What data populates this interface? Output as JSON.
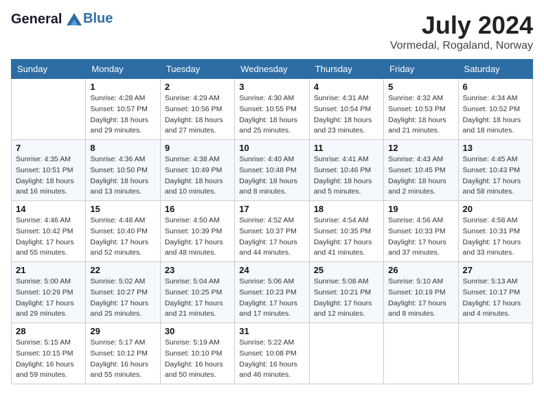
{
  "header": {
    "logo_line1": "General",
    "logo_line2": "Blue",
    "month": "July 2024",
    "location": "Vormedal, Rogaland, Norway"
  },
  "weekdays": [
    "Sunday",
    "Monday",
    "Tuesday",
    "Wednesday",
    "Thursday",
    "Friday",
    "Saturday"
  ],
  "weeks": [
    [
      {
        "day": "",
        "sunrise": "",
        "sunset": "",
        "daylight": ""
      },
      {
        "day": "1",
        "sunrise": "Sunrise: 4:28 AM",
        "sunset": "Sunset: 10:57 PM",
        "daylight": "Daylight: 18 hours and 29 minutes."
      },
      {
        "day": "2",
        "sunrise": "Sunrise: 4:29 AM",
        "sunset": "Sunset: 10:56 PM",
        "daylight": "Daylight: 18 hours and 27 minutes."
      },
      {
        "day": "3",
        "sunrise": "Sunrise: 4:30 AM",
        "sunset": "Sunset: 10:55 PM",
        "daylight": "Daylight: 18 hours and 25 minutes."
      },
      {
        "day": "4",
        "sunrise": "Sunrise: 4:31 AM",
        "sunset": "Sunset: 10:54 PM",
        "daylight": "Daylight: 18 hours and 23 minutes."
      },
      {
        "day": "5",
        "sunrise": "Sunrise: 4:32 AM",
        "sunset": "Sunset: 10:53 PM",
        "daylight": "Daylight: 18 hours and 21 minutes."
      },
      {
        "day": "6",
        "sunrise": "Sunrise: 4:34 AM",
        "sunset": "Sunset: 10:52 PM",
        "daylight": "Daylight: 18 hours and 18 minutes."
      }
    ],
    [
      {
        "day": "7",
        "sunrise": "Sunrise: 4:35 AM",
        "sunset": "Sunset: 10:51 PM",
        "daylight": "Daylight: 18 hours and 16 minutes."
      },
      {
        "day": "8",
        "sunrise": "Sunrise: 4:36 AM",
        "sunset": "Sunset: 10:50 PM",
        "daylight": "Daylight: 18 hours and 13 minutes."
      },
      {
        "day": "9",
        "sunrise": "Sunrise: 4:38 AM",
        "sunset": "Sunset: 10:49 PM",
        "daylight": "Daylight: 18 hours and 10 minutes."
      },
      {
        "day": "10",
        "sunrise": "Sunrise: 4:40 AM",
        "sunset": "Sunset: 10:48 PM",
        "daylight": "Daylight: 18 hours and 8 minutes."
      },
      {
        "day": "11",
        "sunrise": "Sunrise: 4:41 AM",
        "sunset": "Sunset: 10:46 PM",
        "daylight": "Daylight: 18 hours and 5 minutes."
      },
      {
        "day": "12",
        "sunrise": "Sunrise: 4:43 AM",
        "sunset": "Sunset: 10:45 PM",
        "daylight": "Daylight: 18 hours and 2 minutes."
      },
      {
        "day": "13",
        "sunrise": "Sunrise: 4:45 AM",
        "sunset": "Sunset: 10:43 PM",
        "daylight": "Daylight: 17 hours and 58 minutes."
      }
    ],
    [
      {
        "day": "14",
        "sunrise": "Sunrise: 4:46 AM",
        "sunset": "Sunset: 10:42 PM",
        "daylight": "Daylight: 17 hours and 55 minutes."
      },
      {
        "day": "15",
        "sunrise": "Sunrise: 4:48 AM",
        "sunset": "Sunset: 10:40 PM",
        "daylight": "Daylight: 17 hours and 52 minutes."
      },
      {
        "day": "16",
        "sunrise": "Sunrise: 4:50 AM",
        "sunset": "Sunset: 10:39 PM",
        "daylight": "Daylight: 17 hours and 48 minutes."
      },
      {
        "day": "17",
        "sunrise": "Sunrise: 4:52 AM",
        "sunset": "Sunset: 10:37 PM",
        "daylight": "Daylight: 17 hours and 44 minutes."
      },
      {
        "day": "18",
        "sunrise": "Sunrise: 4:54 AM",
        "sunset": "Sunset: 10:35 PM",
        "daylight": "Daylight: 17 hours and 41 minutes."
      },
      {
        "day": "19",
        "sunrise": "Sunrise: 4:56 AM",
        "sunset": "Sunset: 10:33 PM",
        "daylight": "Daylight: 17 hours and 37 minutes."
      },
      {
        "day": "20",
        "sunrise": "Sunrise: 4:58 AM",
        "sunset": "Sunset: 10:31 PM",
        "daylight": "Daylight: 17 hours and 33 minutes."
      }
    ],
    [
      {
        "day": "21",
        "sunrise": "Sunrise: 5:00 AM",
        "sunset": "Sunset: 10:29 PM",
        "daylight": "Daylight: 17 hours and 29 minutes."
      },
      {
        "day": "22",
        "sunrise": "Sunrise: 5:02 AM",
        "sunset": "Sunset: 10:27 PM",
        "daylight": "Daylight: 17 hours and 25 minutes."
      },
      {
        "day": "23",
        "sunrise": "Sunrise: 5:04 AM",
        "sunset": "Sunset: 10:25 PM",
        "daylight": "Daylight: 17 hours and 21 minutes."
      },
      {
        "day": "24",
        "sunrise": "Sunrise: 5:06 AM",
        "sunset": "Sunset: 10:23 PM",
        "daylight": "Daylight: 17 hours and 17 minutes."
      },
      {
        "day": "25",
        "sunrise": "Sunrise: 5:08 AM",
        "sunset": "Sunset: 10:21 PM",
        "daylight": "Daylight: 17 hours and 12 minutes."
      },
      {
        "day": "26",
        "sunrise": "Sunrise: 5:10 AM",
        "sunset": "Sunset: 10:19 PM",
        "daylight": "Daylight: 17 hours and 8 minutes."
      },
      {
        "day": "27",
        "sunrise": "Sunrise: 5:13 AM",
        "sunset": "Sunset: 10:17 PM",
        "daylight": "Daylight: 17 hours and 4 minutes."
      }
    ],
    [
      {
        "day": "28",
        "sunrise": "Sunrise: 5:15 AM",
        "sunset": "Sunset: 10:15 PM",
        "daylight": "Daylight: 16 hours and 59 minutes."
      },
      {
        "day": "29",
        "sunrise": "Sunrise: 5:17 AM",
        "sunset": "Sunset: 10:12 PM",
        "daylight": "Daylight: 16 hours and 55 minutes."
      },
      {
        "day": "30",
        "sunrise": "Sunrise: 5:19 AM",
        "sunset": "Sunset: 10:10 PM",
        "daylight": "Daylight: 16 hours and 50 minutes."
      },
      {
        "day": "31",
        "sunrise": "Sunrise: 5:22 AM",
        "sunset": "Sunset: 10:08 PM",
        "daylight": "Daylight: 16 hours and 46 minutes."
      },
      {
        "day": "",
        "sunrise": "",
        "sunset": "",
        "daylight": ""
      },
      {
        "day": "",
        "sunrise": "",
        "sunset": "",
        "daylight": ""
      },
      {
        "day": "",
        "sunrise": "",
        "sunset": "",
        "daylight": ""
      }
    ]
  ]
}
